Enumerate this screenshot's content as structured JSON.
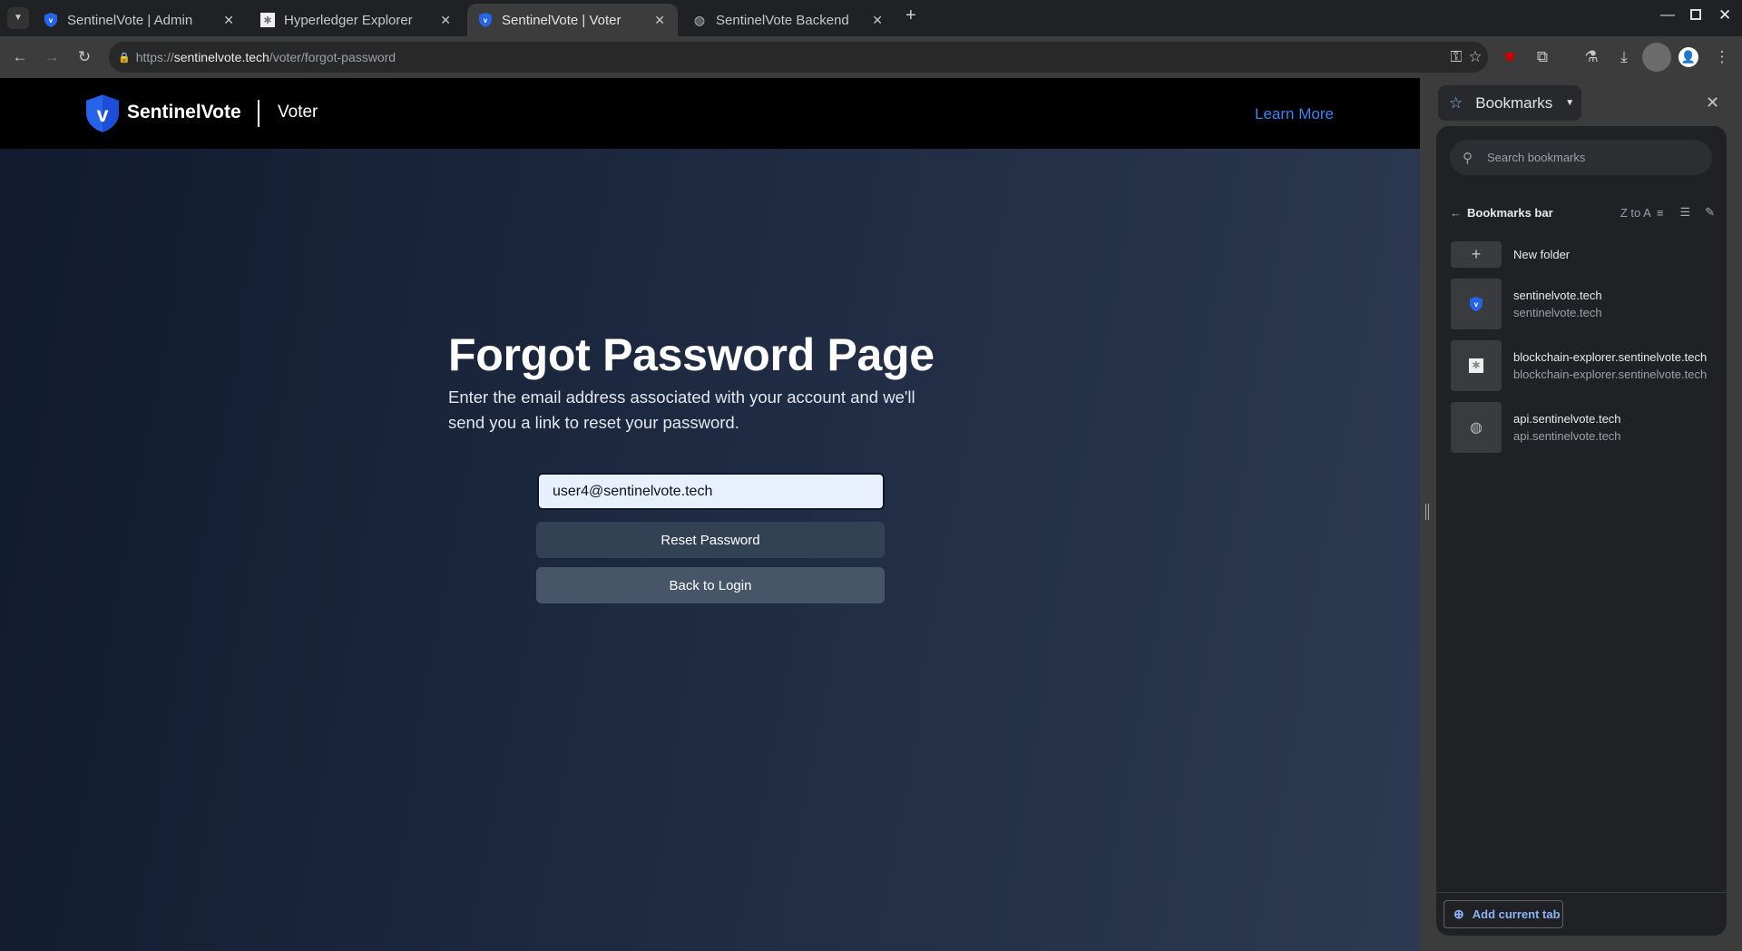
{
  "browser": {
    "tabs": [
      {
        "title": "SentinelVote | Admin",
        "icon": "shield-v-icon",
        "active": false
      },
      {
        "title": "Hyperledger Explorer",
        "icon": "hyperledger-icon",
        "active": false
      },
      {
        "title": "SentinelVote | Voter",
        "icon": "shield-v-icon",
        "active": true
      },
      {
        "title": "SentinelVote Backend",
        "icon": "globe-icon",
        "active": false
      }
    ],
    "url_prefix": "https://",
    "url_host": "sentinelvote.tech",
    "url_path": "/voter/forgot-password"
  },
  "site": {
    "brand": "SentinelVote",
    "section": "Voter",
    "learn_more": "Learn More",
    "brand_color": "#2563eb"
  },
  "main": {
    "title": "Forgot Password Page",
    "subtitle": "Enter the email address associated with your account and we'll send you a link to reset your password.",
    "email_value": "user4@sentinelvote.tech",
    "reset_label": "Reset Password",
    "back_label": "Back to Login"
  },
  "bookmarks": {
    "title": "Bookmarks",
    "search_placeholder": "Search bookmarks",
    "folder": "Bookmarks bar",
    "sort": "Z to A",
    "new_folder": "New folder",
    "items": [
      {
        "title": "sentinelvote.tech",
        "url": "sentinelvote.tech",
        "icon": "shield-v-icon"
      },
      {
        "title": "blockchain-explorer.sentinelvote.tech",
        "url": "blockchain-explorer.sentinelvote.tech",
        "icon": "hyperledger-icon"
      },
      {
        "title": "api.sentinelvote.tech",
        "url": "api.sentinelvote.tech",
        "icon": "globe-icon"
      }
    ],
    "add_current_tab": "Add current tab"
  }
}
